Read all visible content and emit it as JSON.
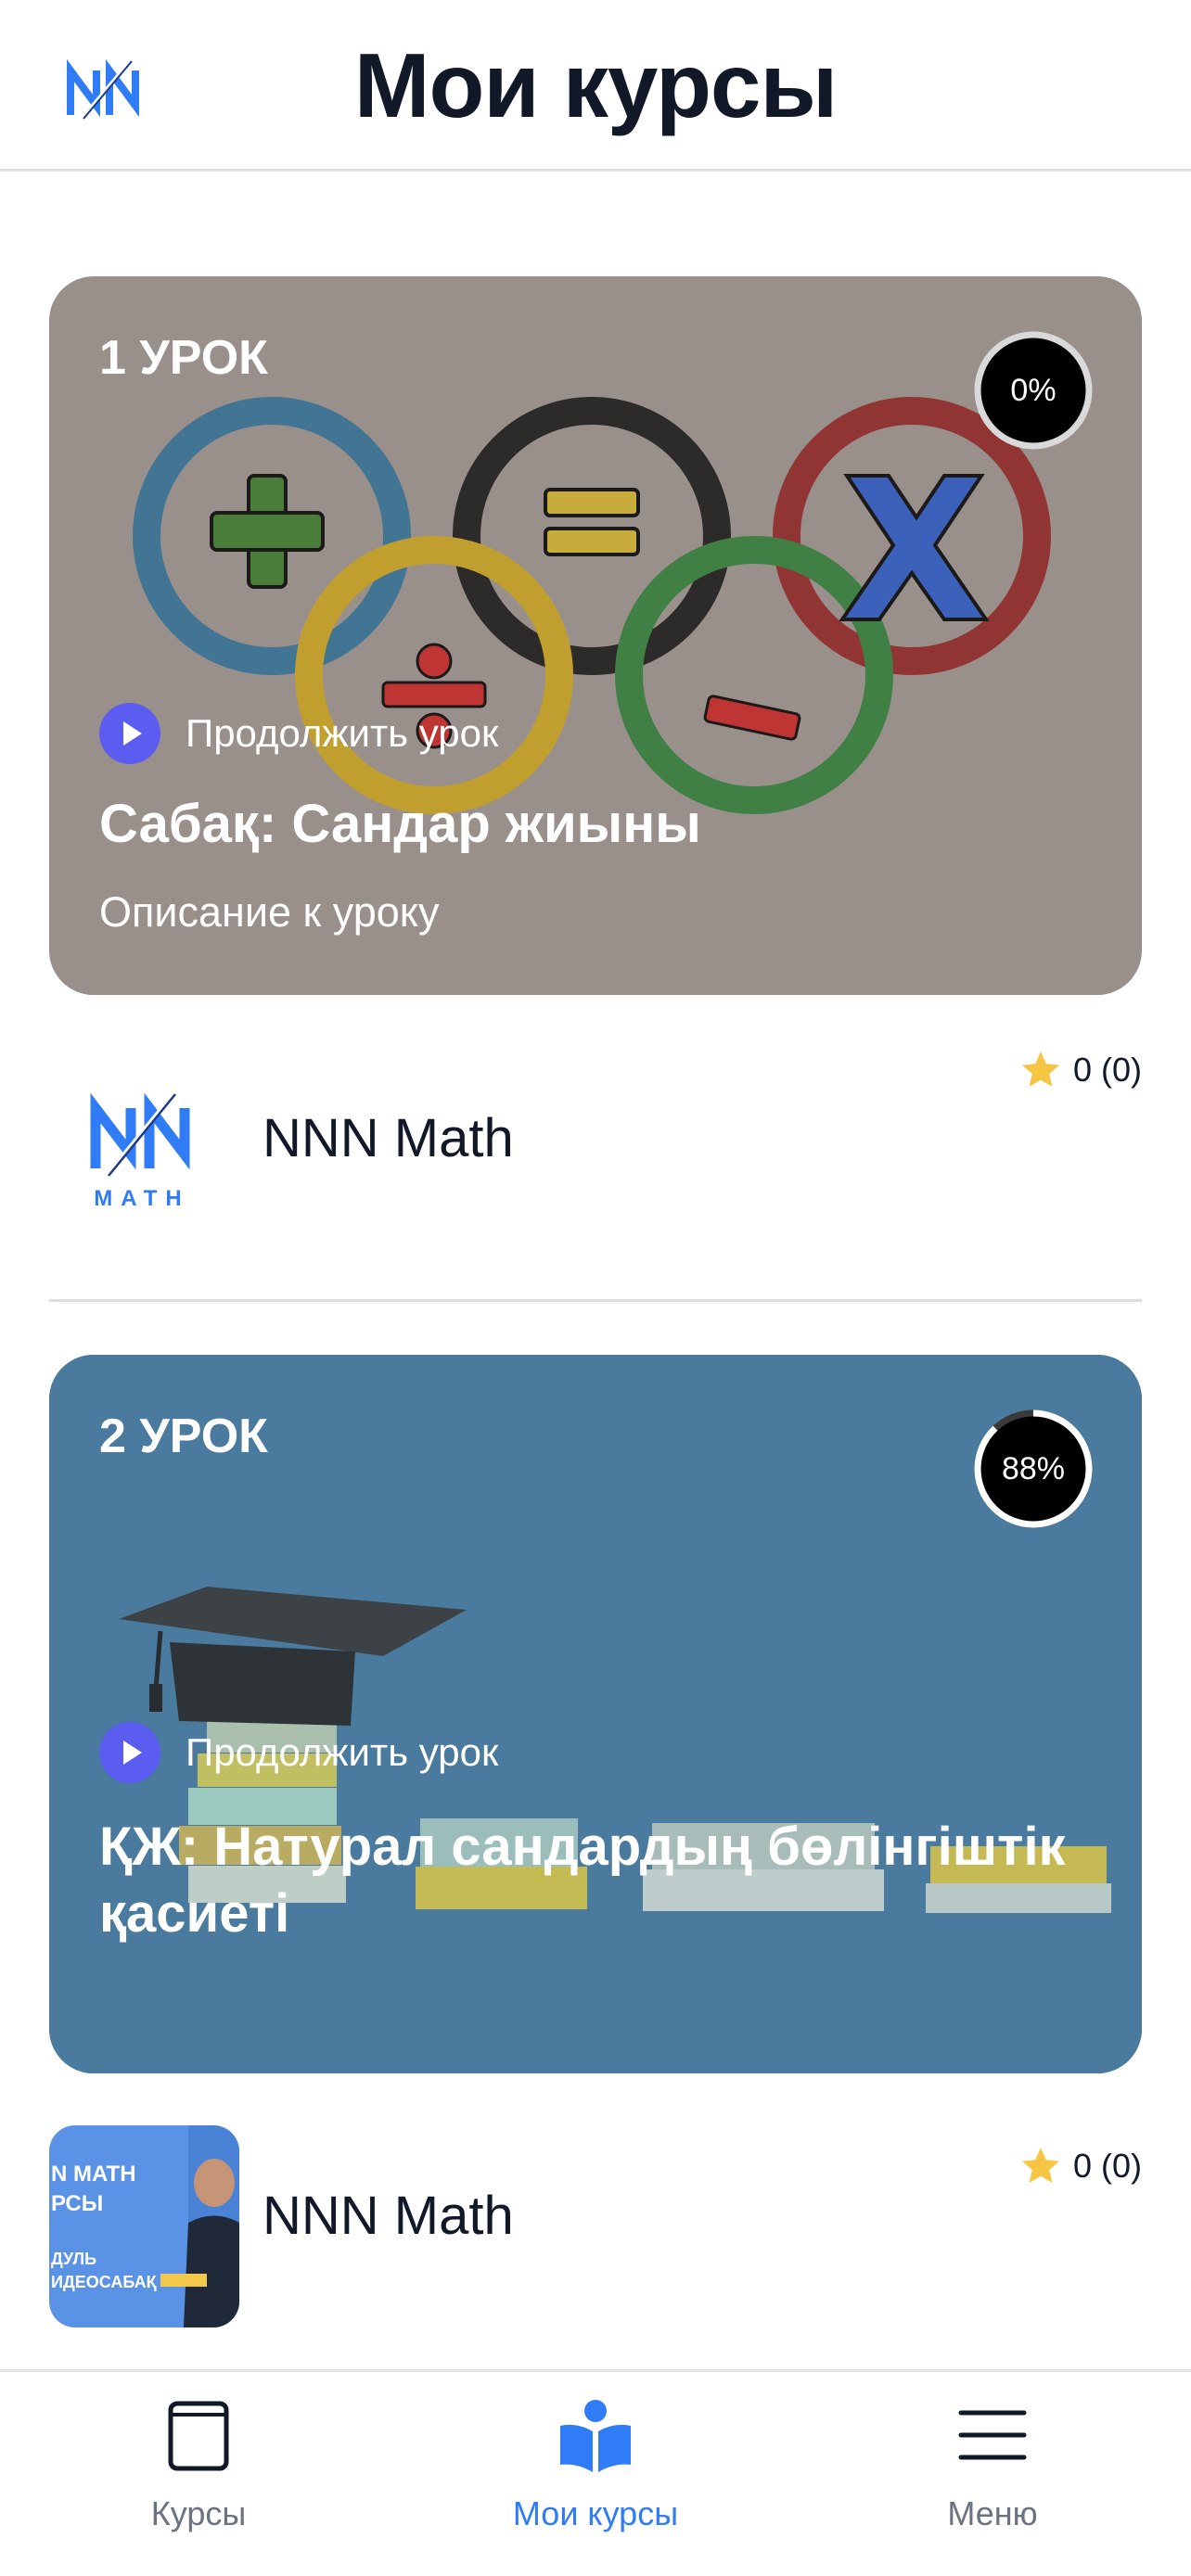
{
  "header": {
    "title": "Мои курсы",
    "logo": "nnn-logo"
  },
  "courses": [
    {
      "lesson_number": "1 УРОК",
      "progress_label": "0%",
      "progress": 0,
      "continue_label": "Продолжить урок",
      "title": "Сабақ: Сандар жиыны",
      "description": "Описание к уроку",
      "author": "NNN Math",
      "rating": "0 (0)"
    },
    {
      "lesson_number": "2 УРОК",
      "progress_label": "88%",
      "progress": 0.88,
      "continue_label": "Продолжить урок",
      "title": "ҚЖ:  Натурал сандардың бөлінгіштік қасиеті",
      "author": "NNN Math",
      "rating": "0 (0)"
    }
  ],
  "avatar2_text": {
    "line1": "N MATH",
    "line2": "РСЫ",
    "line3": "ДУЛЬ",
    "line4": "ИДЕОСАБАҚ"
  },
  "tabbar": {
    "items": [
      {
        "label": "Курсы",
        "icon": "book-icon"
      },
      {
        "label": "Мои курсы",
        "icon": "reader-icon"
      },
      {
        "label": "Меню",
        "icon": "menu-icon"
      }
    ],
    "active": "Мои курсы"
  },
  "colors": {
    "accent": "#2f7cf6",
    "play_button": "#5b5cf0",
    "card1_bg": "#9a918c",
    "card2_bg": "#4a7a9e",
    "star": "#f7c544"
  }
}
